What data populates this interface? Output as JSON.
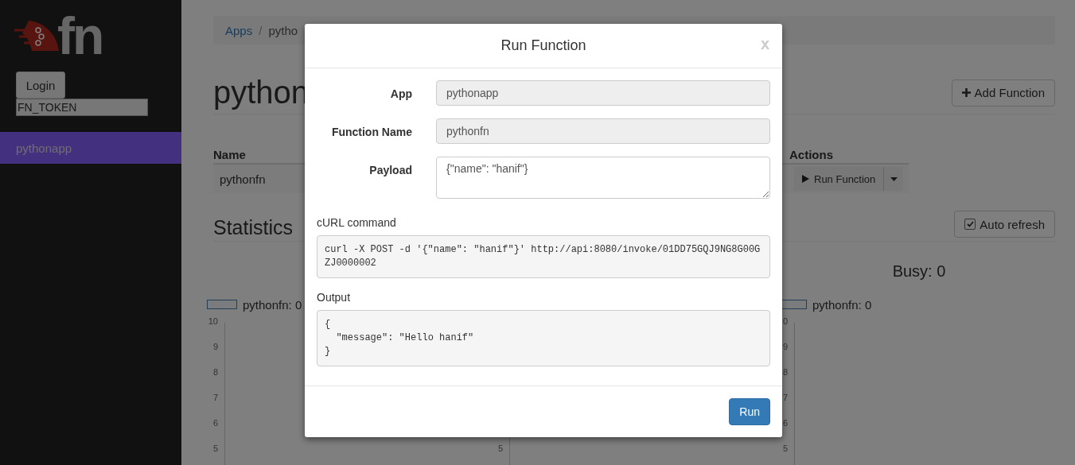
{
  "sidebar": {
    "logo_text": "fn",
    "login_button": "Login",
    "token_field": {
      "value": "FN_TOKEN"
    },
    "items": [
      {
        "label": "pythonapp",
        "selected": true
      }
    ]
  },
  "breadcrumb": [
    "Apps",
    "pytho"
  ],
  "breadcrumb_separator": "/",
  "page_title": "python",
  "add_button": "Add Function",
  "functions_table": {
    "columns": [
      "Name",
      "Actions"
    ],
    "rows": [
      {
        "name": "pythonfn",
        "action": "Run Function"
      }
    ]
  },
  "statistics": {
    "title": "Statistics",
    "auto_refresh": {
      "label": "Auto refresh",
      "checked": true
    },
    "charts": [
      {
        "legend": "pythonfn: 0",
        "ticks": [
          "10",
          "9",
          "8",
          "7",
          "6",
          "5"
        ]
      },
      {
        "ticks": [
          "5"
        ]
      },
      {
        "title": "Busy: 0",
        "legend": "pythonfn: 0",
        "ticks": [
          "0",
          "9",
          "8",
          "7",
          "6",
          "5"
        ]
      }
    ]
  },
  "modal": {
    "title": "Run Function",
    "close": "x",
    "fields": [
      {
        "label": "App",
        "value": "pythonapp",
        "kind": "readonly"
      },
      {
        "label": "Function Name",
        "value": "pythonfn",
        "kind": "readonly"
      },
      {
        "label": "Payload",
        "value": "{\"name\": \"hanif\"}",
        "kind": "textarea"
      }
    ],
    "curl_label": "cURL command",
    "curl": "curl -X POST -d '{\"name\": \"hanif\"}' http://api:8080/invoke/01DD75GQJ9NG8G00GZJ0000002",
    "output_label": "Output",
    "output": "{\n  \"message\": \"Hello hanif\"\n}",
    "run_button": "Run"
  }
}
